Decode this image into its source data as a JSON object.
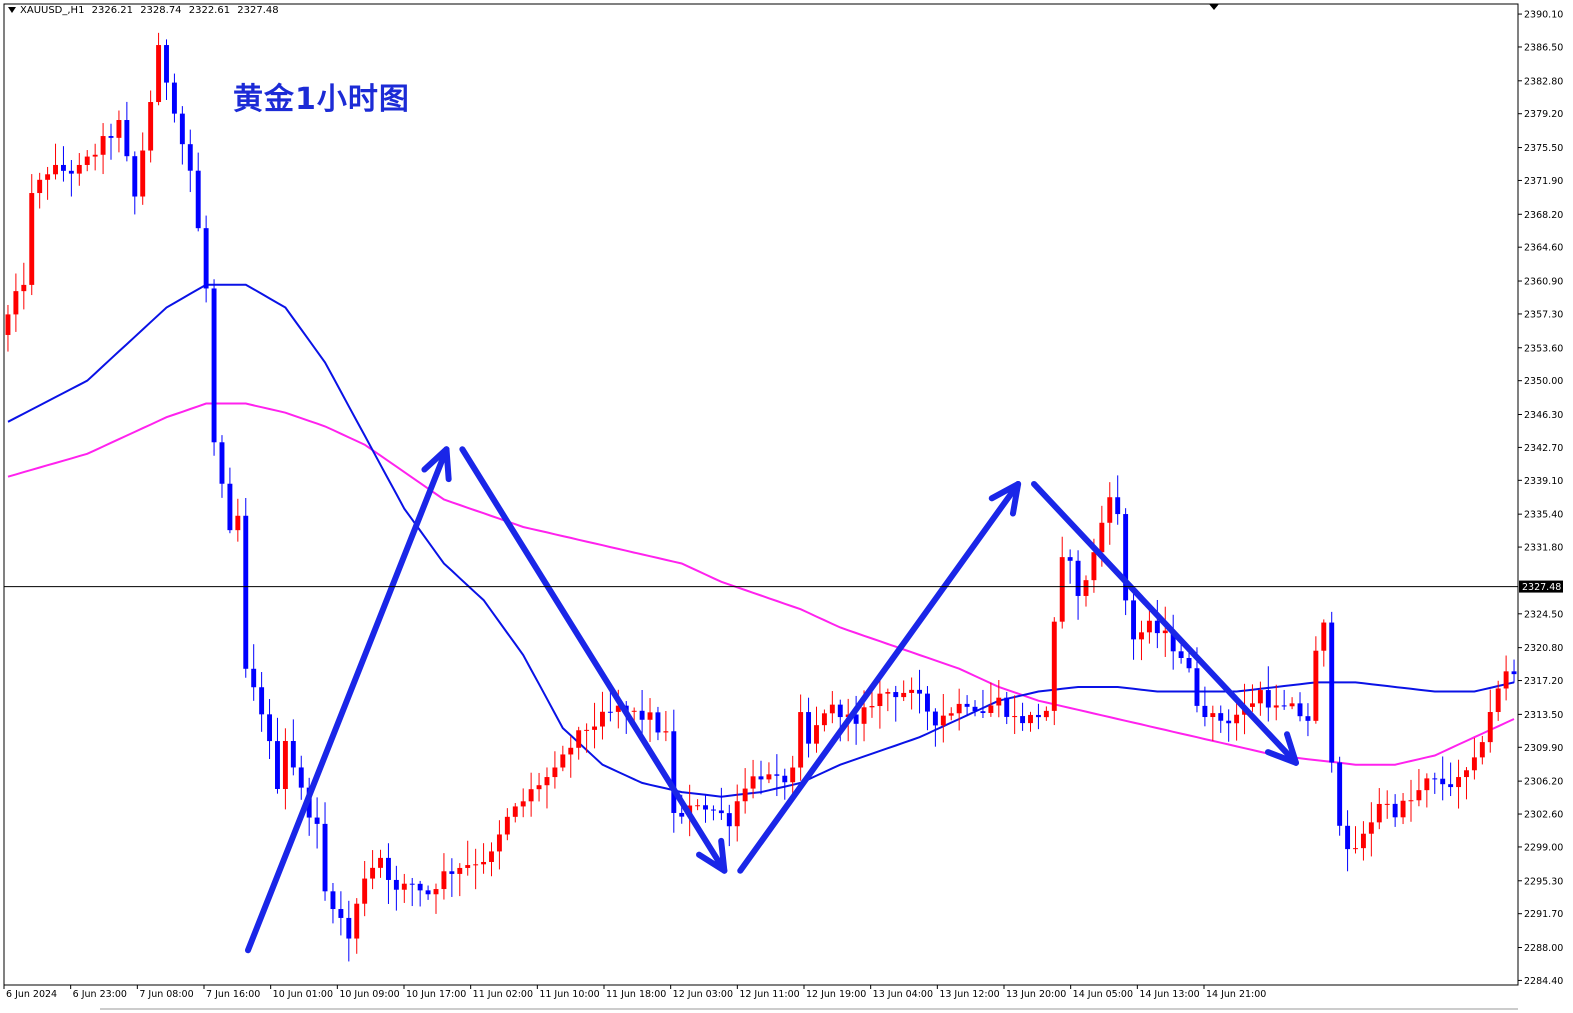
{
  "header": {
    "symbol": "XAUUSD_,H1",
    "open": "2326.21",
    "high": "2328.74",
    "low": "2322.61",
    "close": "2327.48"
  },
  "title": "黄金1小时图",
  "colors": {
    "bull": "#ff0000",
    "bear": "#0000ff",
    "ma_fast": "#0a12e6",
    "ma_slow": "#ff22ee",
    "arrows": "#1a26e8",
    "title": "#1c2bd6",
    "price_line": "#000000"
  },
  "chart_data": {
    "type": "candlestick",
    "symbol": "XAUUSD_",
    "timeframe": "H1",
    "y_ticks": [
      "2390.10",
      "2386.50",
      "2382.80",
      "2379.20",
      "2375.50",
      "2371.90",
      "2368.20",
      "2364.60",
      "2360.90",
      "2357.30",
      "2353.60",
      "2350.00",
      "2346.30",
      "2342.70",
      "2339.10",
      "2335.40",
      "2331.80",
      "2324.50",
      "2320.80",
      "2317.20",
      "2313.50",
      "2309.90",
      "2306.20",
      "2302.60",
      "2299.00",
      "2295.30",
      "2291.70",
      "2288.00",
      "2284.40"
    ],
    "ylim": [
      2283.9,
      2391.2
    ],
    "current_price": "2327.48",
    "x_ticks": [
      "6 Jun 2024",
      "6 Jun 23:00",
      "7 Jun 08:00",
      "7 Jun 16:00",
      "10 Jun 01:00",
      "10 Jun 09:00",
      "10 Jun 17:00",
      "11 Jun 02:00",
      "11 Jun 10:00",
      "11 Jun 18:00",
      "12 Jun 03:00",
      "12 Jun 11:00",
      "12 Jun 19:00",
      "13 Jun 04:00",
      "13 Jun 12:00",
      "13 Jun 20:00",
      "14 Jun 05:00",
      "14 Jun 13:00",
      "14 Jun 21:00"
    ],
    "candle_count": 191,
    "anchors": [
      [
        0,
        2355
      ],
      [
        3,
        2361
      ],
      [
        4,
        2370
      ],
      [
        6,
        2373
      ],
      [
        10,
        2373
      ],
      [
        12,
        2375
      ],
      [
        15,
        2378
      ],
      [
        17,
        2370
      ],
      [
        20,
        2386
      ],
      [
        22,
        2380
      ],
      [
        23,
        2376
      ],
      [
        24,
        2373
      ],
      [
        26,
        2360
      ],
      [
        27,
        2343
      ],
      [
        29,
        2333
      ],
      [
        30,
        2335
      ],
      [
        31,
        2318
      ],
      [
        33,
        2314
      ],
      [
        35,
        2306
      ],
      [
        36,
        2311
      ],
      [
        38,
        2305
      ],
      [
        40,
        2301
      ],
      [
        41,
        2294
      ],
      [
        42,
        2293
      ],
      [
        44,
        2289
      ],
      [
        46,
        2296
      ],
      [
        48,
        2298
      ],
      [
        50,
        2294
      ],
      [
        52,
        2295
      ],
      [
        54,
        2294
      ],
      [
        56,
        2296
      ],
      [
        58,
        2297
      ],
      [
        62,
        2298
      ],
      [
        63,
        2300
      ],
      [
        64,
        2302
      ],
      [
        66,
        2304
      ],
      [
        68,
        2306
      ],
      [
        70,
        2307
      ],
      [
        72,
        2310
      ],
      [
        74,
        2312
      ],
      [
        76,
        2313
      ],
      [
        78,
        2314
      ],
      [
        82,
        2313
      ],
      [
        84,
        2311
      ],
      [
        85,
        2303
      ],
      [
        86,
        2302
      ],
      [
        88,
        2304
      ],
      [
        90,
        2303
      ],
      [
        92,
        2302
      ],
      [
        94,
        2306
      ],
      [
        96,
        2307
      ],
      [
        98,
        2306
      ],
      [
        100,
        2307
      ],
      [
        101,
        2313
      ],
      [
        102,
        2310
      ],
      [
        104,
        2314
      ],
      [
        106,
        2314
      ],
      [
        108,
        2312
      ],
      [
        110,
        2315
      ],
      [
        112,
        2316
      ],
      [
        114,
        2316
      ],
      [
        116,
        2315
      ],
      [
        118,
        2313
      ],
      [
        120,
        2314
      ],
      [
        122,
        2315
      ],
      [
        124,
        2314
      ],
      [
        126,
        2315
      ],
      [
        128,
        2313
      ],
      [
        130,
        2313
      ],
      [
        132,
        2314
      ],
      [
        133,
        2323
      ],
      [
        134,
        2330
      ],
      [
        135,
        2331
      ],
      [
        136,
        2326
      ],
      [
        138,
        2331
      ],
      [
        140,
        2338
      ],
      [
        141,
        2335
      ],
      [
        142,
        2326
      ],
      [
        143,
        2322
      ],
      [
        145,
        2323
      ],
      [
        147,
        2322
      ],
      [
        149,
        2320
      ],
      [
        150,
        2318
      ],
      [
        151,
        2315
      ],
      [
        153,
        2313
      ],
      [
        155,
        2313
      ],
      [
        157,
        2314
      ],
      [
        159,
        2316
      ],
      [
        161,
        2314
      ],
      [
        163,
        2314
      ],
      [
        165,
        2313
      ],
      [
        166,
        2320
      ],
      [
        167,
        2323
      ],
      [
        168,
        2309
      ],
      [
        169,
        2302
      ],
      [
        170,
        2298
      ],
      [
        172,
        2300
      ],
      [
        174,
        2304
      ],
      [
        176,
        2303
      ],
      [
        178,
        2304
      ],
      [
        180,
        2306
      ],
      [
        182,
        2306
      ],
      [
        184,
        2306
      ],
      [
        186,
        2308
      ],
      [
        188,
        2314
      ],
      [
        190,
        2318
      ]
    ],
    "ma_fast": [
      [
        0,
        2345.5
      ],
      [
        10,
        2350
      ],
      [
        20,
        2358
      ],
      [
        25,
        2360.5
      ],
      [
        30,
        2360.5
      ],
      [
        35,
        2358
      ],
      [
        40,
        2352
      ],
      [
        45,
        2344
      ],
      [
        50,
        2336
      ],
      [
        55,
        2330
      ],
      [
        60,
        2326
      ],
      [
        65,
        2320
      ],
      [
        70,
        2312
      ],
      [
        75,
        2308
      ],
      [
        80,
        2306
      ],
      [
        85,
        2305
      ],
      [
        90,
        2304.5
      ],
      [
        95,
        2305
      ],
      [
        100,
        2306
      ],
      [
        105,
        2308
      ],
      [
        110,
        2309.5
      ],
      [
        115,
        2311
      ],
      [
        120,
        2313
      ],
      [
        125,
        2315
      ],
      [
        130,
        2316
      ],
      [
        135,
        2316.5
      ],
      [
        140,
        2316.5
      ],
      [
        145,
        2316
      ],
      [
        150,
        2316
      ],
      [
        155,
        2316
      ],
      [
        160,
        2316.5
      ],
      [
        165,
        2317
      ],
      [
        170,
        2317
      ],
      [
        175,
        2316.5
      ],
      [
        180,
        2316
      ],
      [
        185,
        2316
      ],
      [
        190,
        2317
      ]
    ],
    "ma_slow": [
      [
        0,
        2339.5
      ],
      [
        10,
        2342
      ],
      [
        20,
        2346
      ],
      [
        25,
        2347.5
      ],
      [
        30,
        2347.5
      ],
      [
        35,
        2346.5
      ],
      [
        40,
        2345
      ],
      [
        45,
        2343
      ],
      [
        50,
        2340
      ],
      [
        55,
        2337
      ],
      [
        60,
        2335.5
      ],
      [
        65,
        2334
      ],
      [
        70,
        2333
      ],
      [
        75,
        2332
      ],
      [
        80,
        2331
      ],
      [
        85,
        2330
      ],
      [
        90,
        2328
      ],
      [
        95,
        2326.5
      ],
      [
        100,
        2325
      ],
      [
        105,
        2323
      ],
      [
        110,
        2321.5
      ],
      [
        115,
        2320
      ],
      [
        120,
        2318.5
      ],
      [
        125,
        2316.5
      ],
      [
        130,
        2315
      ],
      [
        135,
        2314
      ],
      [
        140,
        2313
      ],
      [
        145,
        2312
      ],
      [
        150,
        2311
      ],
      [
        155,
        2310
      ],
      [
        160,
        2309
      ],
      [
        165,
        2308.5
      ],
      [
        170,
        2308
      ],
      [
        175,
        2308
      ],
      [
        180,
        2309
      ],
      [
        185,
        2311
      ],
      [
        190,
        2313
      ]
    ],
    "annotation_arrows": [
      {
        "from": [
          2288,
          2287.7
        ],
        "to": [
          2313,
          2342.5
        ]
      },
      {
        "from": [
          2315,
          2342.5
        ],
        "to": [
          2348,
          2296.4
        ]
      },
      {
        "from": [
          2350,
          2296.4
        ],
        "to": [
          2385,
          2338.7
        ]
      },
      {
        "from": [
          2387,
          2338.7
        ],
        "to": [
          2420,
          2308.2
        ]
      }
    ],
    "grid": false,
    "legend": "none"
  }
}
